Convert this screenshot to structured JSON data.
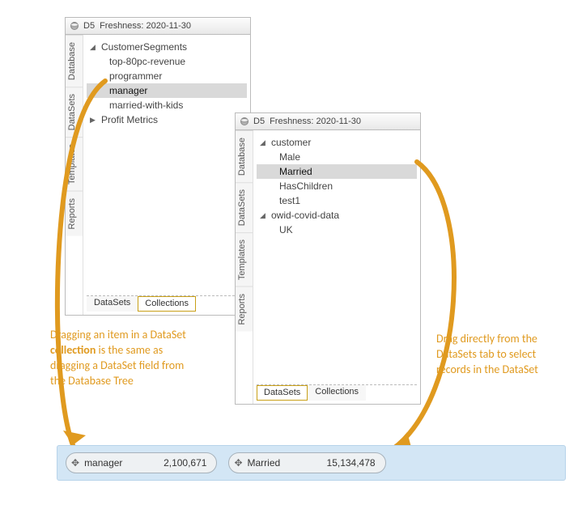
{
  "panel1": {
    "header": {
      "db_label": "D5",
      "freshness": "Freshness: 2020-11-30"
    },
    "vtabs": [
      "Database",
      "DataSets",
      "Templates",
      "Reports"
    ],
    "tree": [
      {
        "type": "group",
        "label": "CustomerSegments",
        "expanded": true
      },
      {
        "type": "child",
        "label": "top-80pc-revenue"
      },
      {
        "type": "child",
        "label": "programmer"
      },
      {
        "type": "child",
        "label": "manager",
        "selected": true
      },
      {
        "type": "child",
        "label": "married-with-kids"
      },
      {
        "type": "group",
        "label": "Profit Metrics",
        "expanded": false
      }
    ],
    "bottom_tabs": {
      "datasets": "DataSets",
      "collections": "Collections",
      "highlight": "collections"
    }
  },
  "panel2": {
    "header": {
      "db_label": "D5",
      "freshness": "Freshness: 2020-11-30"
    },
    "vtabs": [
      "Database",
      "DataSets",
      "Templates",
      "Reports"
    ],
    "tree": [
      {
        "type": "group",
        "label": "customer",
        "expanded": true
      },
      {
        "type": "child",
        "label": "Male"
      },
      {
        "type": "child",
        "label": "Married",
        "selected": true
      },
      {
        "type": "child",
        "label": "HasChildren"
      },
      {
        "type": "child",
        "label": "test1"
      },
      {
        "type": "group",
        "label": "owid-covid-data",
        "expanded": true
      },
      {
        "type": "child",
        "label": "UK"
      }
    ],
    "bottom_tabs": {
      "datasets": "DataSets",
      "collections": "Collections",
      "highlight": "datasets"
    }
  },
  "annotations": {
    "left_pre": "Dragging an item in a DataSet ",
    "left_bold": "collection",
    "left_post": " is the same as dragging a DataSet field from the Database Tree",
    "right": "Drag directly from the DataSets tab to select records in the DataSet"
  },
  "dropbar": {
    "chips": [
      {
        "label": "manager",
        "count": "2,100,671"
      },
      {
        "label": "Married",
        "count": "15,134,478"
      }
    ]
  }
}
